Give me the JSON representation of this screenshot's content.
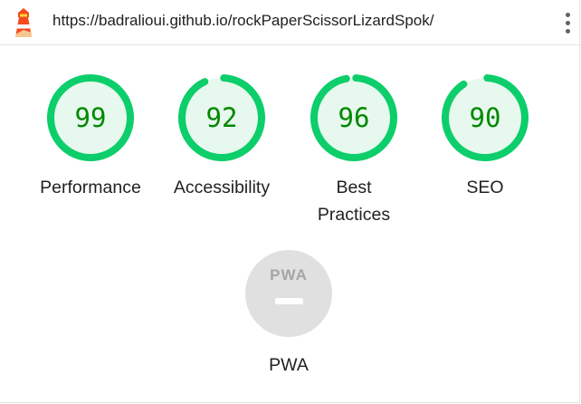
{
  "report": {
    "url": "https://badralioui.github.io/rockPaperScissorLizardSpok/"
  },
  "icons": {
    "logo": "lighthouse-icon",
    "menu": "more-vert-icon"
  },
  "colors": {
    "pass": "#0cce6b",
    "pass_text": "#008800",
    "pass_bg": "#e7f8ee",
    "pwa_badge": "#e0e0e0",
    "pwa_mark": "#a5a5a5"
  },
  "categories": [
    {
      "score": "99",
      "fraction": 0.99,
      "label_lines": [
        "Performance"
      ]
    },
    {
      "score": "92",
      "fraction": 0.92,
      "label_lines": [
        "Accessibility"
      ]
    },
    {
      "score": "96",
      "fraction": 0.96,
      "label_lines": [
        "Best",
        "Practices"
      ]
    },
    {
      "score": "90",
      "fraction": 0.9,
      "label_lines": [
        "SEO"
      ]
    }
  ],
  "pwa": {
    "badge_text": "PWA",
    "label": "PWA"
  }
}
